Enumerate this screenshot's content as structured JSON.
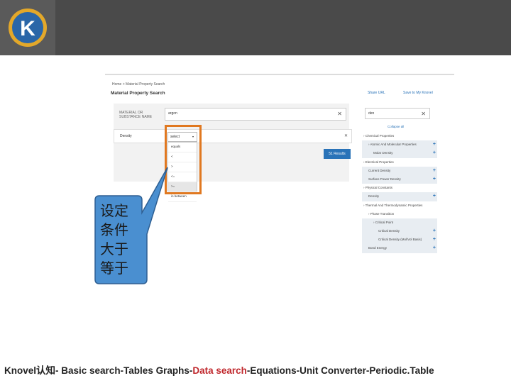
{
  "header": {
    "logo_letter": "K",
    "colors": {
      "bar": "#4a4a4a",
      "logo_ring": "#e3a82a",
      "logo_blue": "#2a66a8"
    }
  },
  "screenshot": {
    "breadcrumb": "Home > Material Property Search",
    "page_title": "Material Property Search",
    "share_link": "Share URL",
    "save_link": "Save to My Knovel",
    "material_label": "MATERIAL OR SUBSTANCE NAME",
    "material_value": "argon",
    "property_label": "Density",
    "operator_selected": "select",
    "operator_options": [
      "equals",
      "<",
      ">",
      "<=",
      ">=",
      "in between"
    ],
    "operator_highlight_index": 4,
    "results_button": "51 Results",
    "property_search_value": "den",
    "collapse_all": "Collapse all",
    "tree": [
      {
        "label": "Chemical Properties",
        "indent": 0,
        "arrow": true
      },
      {
        "label": "Atomic And Molecular Properties",
        "indent": 1,
        "arrow": true,
        "hl": true,
        "plus": true
      },
      {
        "label": "Molar Density",
        "indent": 2,
        "hl": true,
        "plus": true
      },
      {
        "label": "Electrical Properties",
        "indent": 0,
        "arrow": true
      },
      {
        "label": "Current Density",
        "indent": 1,
        "hl": true,
        "plus": true
      },
      {
        "label": "Surface Power Density",
        "indent": 1,
        "hl": true,
        "plus": true
      },
      {
        "label": "Physical Constants",
        "indent": 0,
        "arrow": true
      },
      {
        "label": "Density",
        "indent": 1,
        "hl": true,
        "plus": true
      },
      {
        "label": "Thermal And Thermodynamic Properties",
        "indent": 0,
        "arrow": true
      },
      {
        "label": "Phase Transition",
        "indent": 1,
        "arrow": true
      },
      {
        "label": "Critical Point",
        "indent": 2,
        "arrow": true,
        "hl": true
      },
      {
        "label": "Critical Density",
        "indent": 3,
        "hl": true,
        "plus": true
      },
      {
        "label": "Critical Density (Mol/Vol Basis)",
        "indent": 3,
        "hl": true,
        "plus": true
      },
      {
        "label": "Bond Energy",
        "indent": 1,
        "hl": true,
        "plus": true
      }
    ]
  },
  "callout": {
    "text": "设定条件大于等于",
    "lines": [
      "设定",
      "条件",
      "大于",
      "等于"
    ],
    "colors": {
      "fill": "#4a8fd0",
      "stroke": "#2e5f92",
      "highlight_box": "#e07820"
    }
  },
  "footer": {
    "prefix": "Knovel认知- Basic search-Tables Graphs-",
    "highlight": "Data search",
    "suffix": "-Equations-Unit Converter-Periodic.Table",
    "highlight_color": "#c0282d"
  }
}
